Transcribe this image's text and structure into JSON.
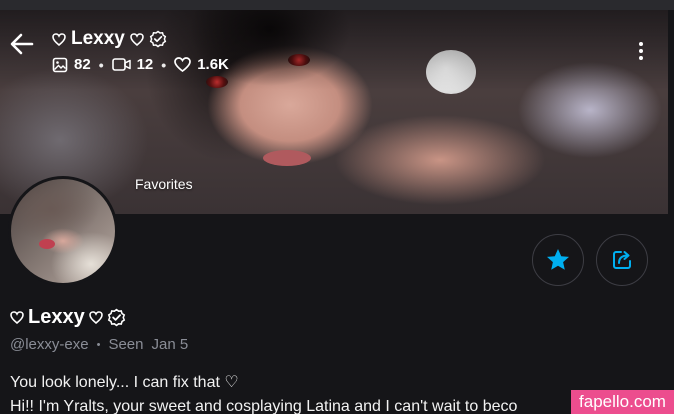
{
  "header": {
    "name": "Lexxy",
    "stats": {
      "photos": "82",
      "videos": "12",
      "likes": "1.6K"
    }
  },
  "cover": {
    "favorites_label": "Favorites"
  },
  "profile": {
    "name": "Lexxy",
    "handle": "@lexxy-exe",
    "separator": "•",
    "seen_label": "Seen",
    "seen_date": "Jan 5",
    "bio_line1": "You look lonely... I can fix that ♡",
    "bio_line2": "Hi!! I'm Yralts, your sweet and cosplaying Latina and I can't wait to beco"
  },
  "watermark": {
    "text": "fapello.com"
  },
  "colors": {
    "accent": "#00aff0",
    "background": "#151518",
    "muted": "#8a8d96",
    "watermark": "#ec4d8e"
  },
  "icons": [
    "back-arrow-icon",
    "heart-outline-icon",
    "verified-badge-icon",
    "photo-icon",
    "video-icon",
    "kebab-menu-icon",
    "star-icon",
    "share-icon"
  ]
}
